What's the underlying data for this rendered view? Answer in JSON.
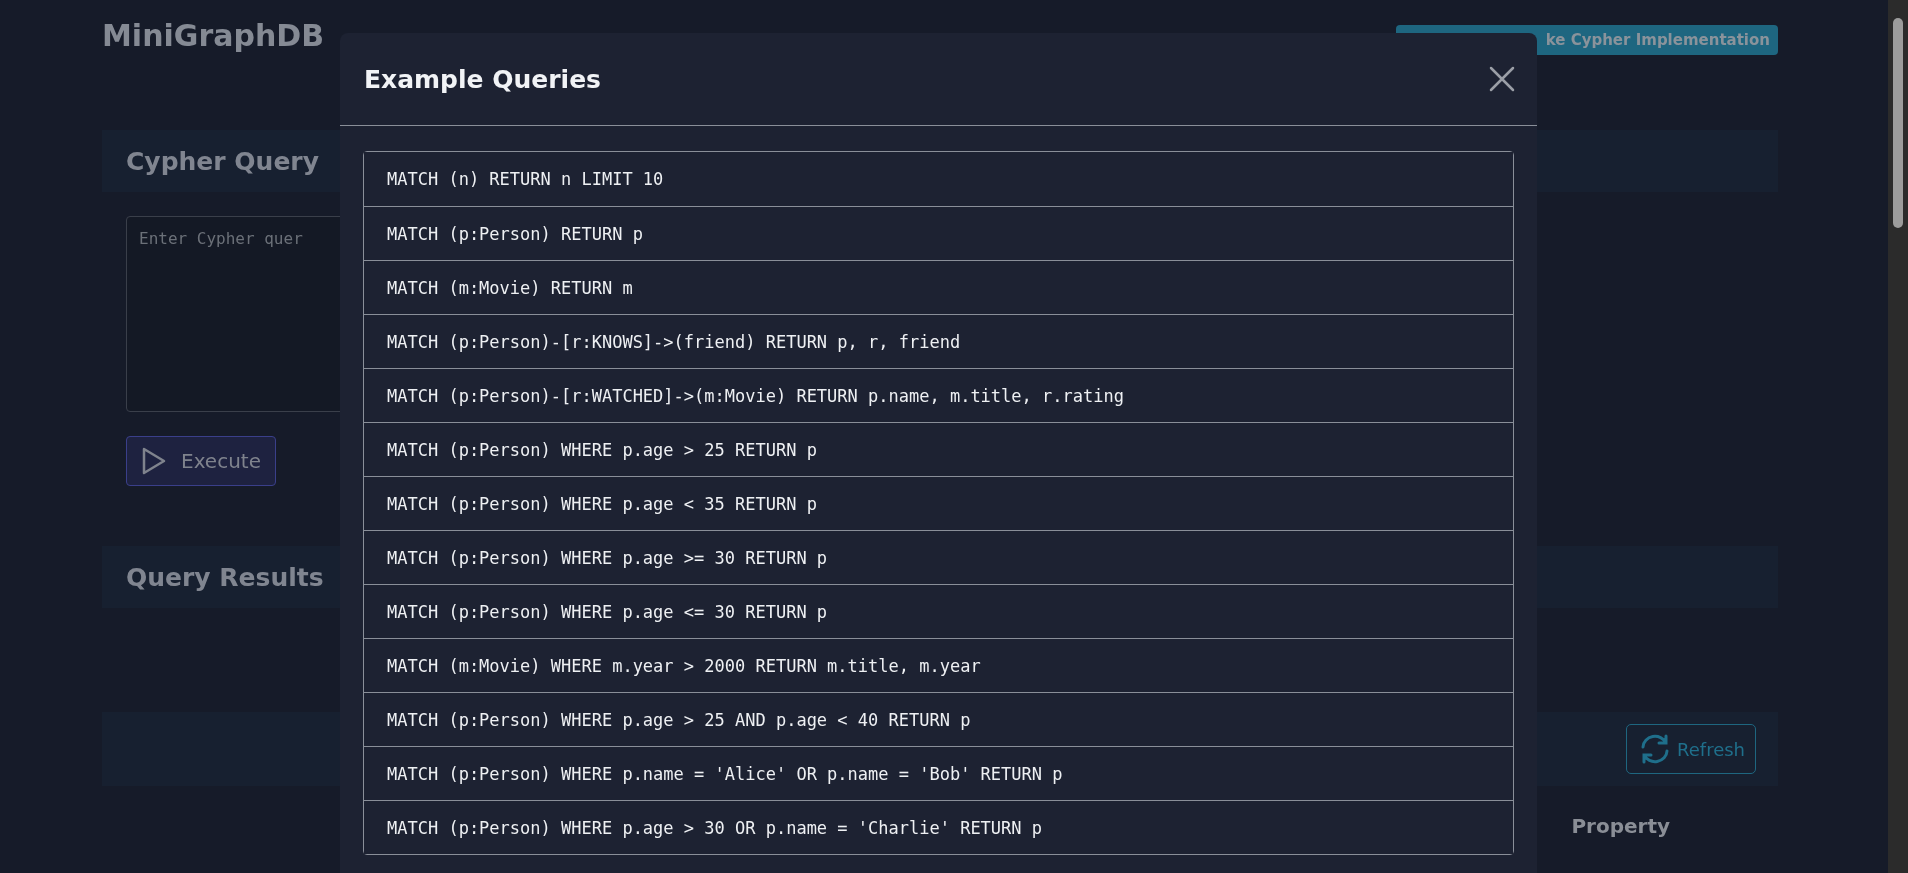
{
  "app": {
    "title": "MiniGraphDB",
    "badge": "ke Cypher Implementation"
  },
  "query_panel": {
    "title": "Cypher Query",
    "placeholder": "Enter Cypher quer",
    "execute_button": "Execute"
  },
  "results_panel": {
    "title": "Query Results"
  },
  "side_panel": {
    "refresh_button": "Refresh",
    "table": {
      "columns": [
        "Property"
      ]
    }
  },
  "modal": {
    "title": "Example Queries",
    "queries": [
      "MATCH (n) RETURN n LIMIT 10",
      "MATCH (p:Person) RETURN p",
      "MATCH (m:Movie) RETURN m",
      "MATCH (p:Person)-[r:KNOWS]->(friend) RETURN p, r, friend",
      "MATCH (p:Person)-[r:WATCHED]->(m:Movie) RETURN p.name, m.title, r.rating",
      "MATCH (p:Person) WHERE p.age > 25 RETURN p",
      "MATCH (p:Person) WHERE p.age < 35 RETURN p",
      "MATCH (p:Person) WHERE p.age >= 30 RETURN p",
      "MATCH (p:Person) WHERE p.age <= 30 RETURN p",
      "MATCH (m:Movie) WHERE m.year > 2000 RETURN m.title, m.year",
      "MATCH (p:Person) WHERE p.age > 25 AND p.age < 40 RETURN p",
      "MATCH (p:Person) WHERE p.name = 'Alice' OR p.name = 'Bob' RETURN p",
      "MATCH (p:Person) WHERE p.age > 30 OR p.name = 'Charlie' RETURN p"
    ]
  }
}
